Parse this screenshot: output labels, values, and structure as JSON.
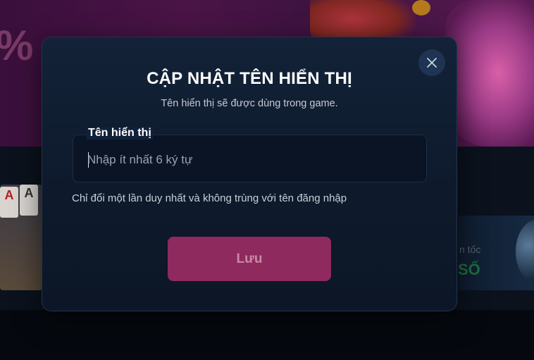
{
  "background": {
    "banner_percent": "%",
    "card_1": "A",
    "card_2": "A",
    "right_text_1": "n tốc",
    "right_text_2": "SỐ"
  },
  "modal": {
    "title": "CẬP NHẬT TÊN HIỂN THỊ",
    "subtitle": "Tên hiển thị sẽ được dùng trong game.",
    "close_icon": "close-icon",
    "field": {
      "label": "Tên hiển thị",
      "value": "",
      "placeholder": "Nhập ít nhất 6 ký tự"
    },
    "hint": "Chỉ đổi một lần duy nhất và không trùng với tên đăng nhập",
    "save_label": "Lưu"
  },
  "colors": {
    "accent": "#8e2a5e",
    "modal_bg": "#132238",
    "page_bg": "#05090f"
  }
}
